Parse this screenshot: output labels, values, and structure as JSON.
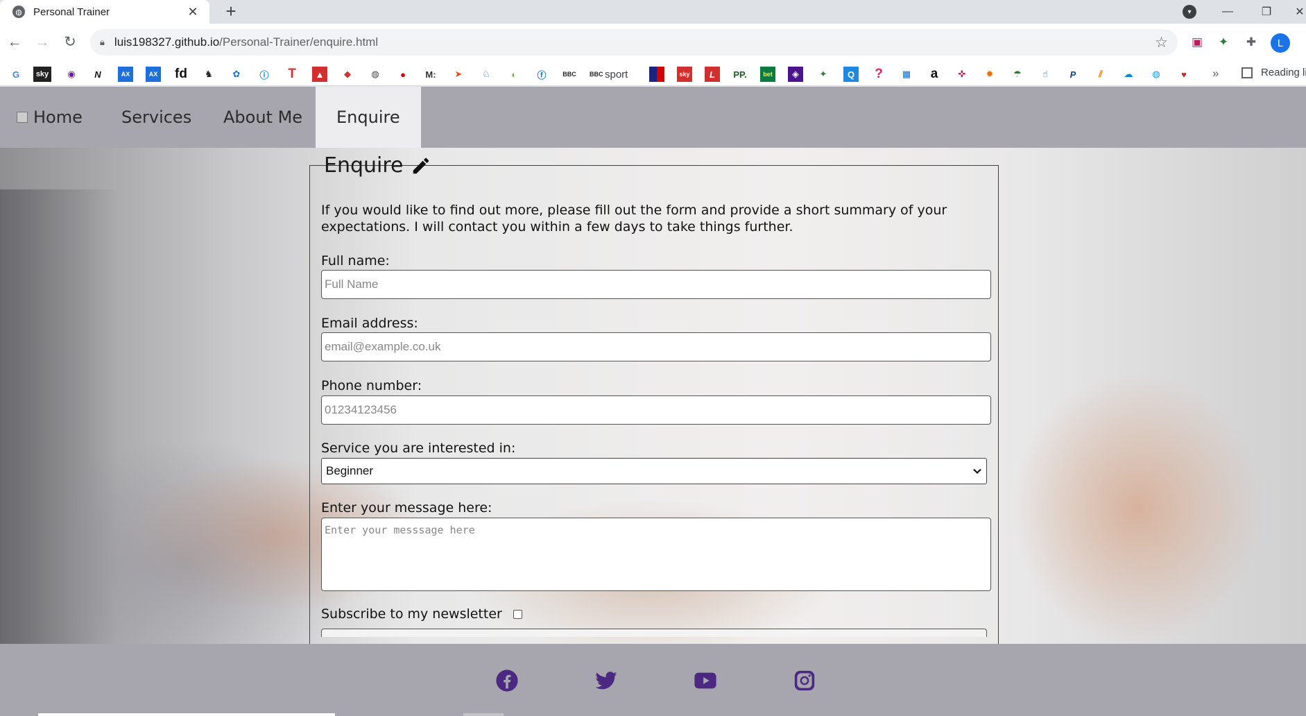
{
  "browser": {
    "tab_title": "Personal Trainer",
    "tab_close": "✕",
    "new_tab": "+",
    "url_host": "luis198327.github.io",
    "url_path": "/Personal-Trainer/enquire.html",
    "profile_initial": "L",
    "bookmark_sport_label": "sport",
    "bookmarks_more": "»",
    "reading_list_label": "Reading li"
  },
  "nav": {
    "home": "Home",
    "services": "Services",
    "about": "About Me",
    "enquire": "Enquire"
  },
  "form": {
    "legend": "Enquire",
    "intro": "If you would like to find out more, please fill out the form and provide a short summary of your expectations. I will contact you within a few days to take things further.",
    "full_name_label": "Full name:",
    "full_name_placeholder": "Full Name",
    "email_label": "Email address:",
    "email_placeholder": "email@example.co.uk",
    "phone_label": "Phone number:",
    "phone_placeholder": "01234123456",
    "service_label": "Service you are interested in:",
    "service_selected": "Beginner",
    "message_label": "Enter your message here:",
    "message_placeholder": "Enter your messsage here",
    "newsletter_label": "Subscribe to my newsletter"
  },
  "footer": {
    "icons": [
      "facebook-icon",
      "twitter-icon",
      "youtube-icon",
      "instagram-icon"
    ],
    "icon_color": "#4b2882"
  },
  "colors": {
    "nav_background": "#a7a6ae",
    "nav_active": "#ededef",
    "accent_blue": "#1a73e8"
  }
}
